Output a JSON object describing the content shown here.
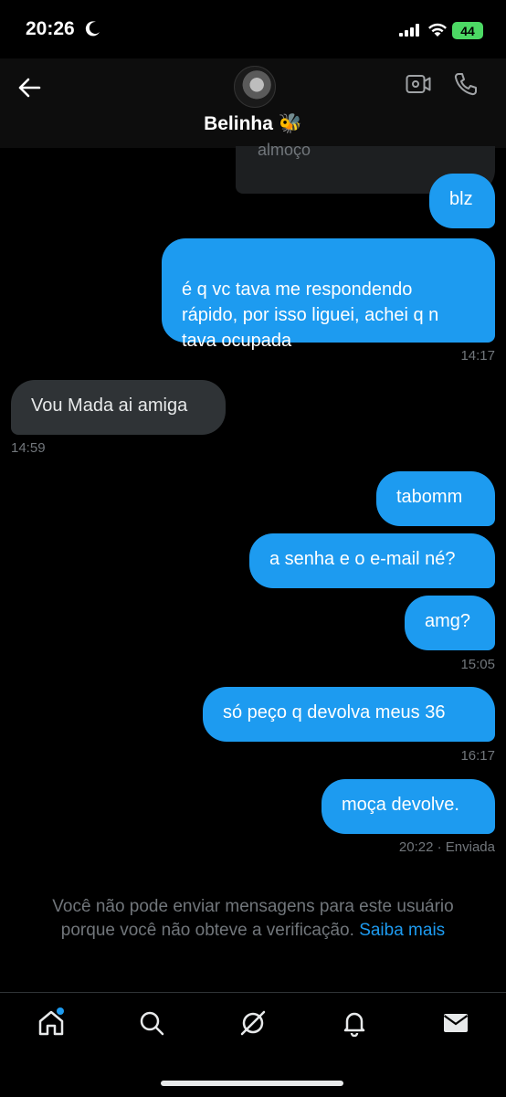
{
  "status_bar": {
    "time": "20:26",
    "battery": "44"
  },
  "header": {
    "contact_name": "Belinha 🐝"
  },
  "partial_message": "almoço",
  "messages": [
    {
      "text": "blz"
    },
    {
      "text": "é q vc tava me respondendo\nrápido, por isso liguei, achei q n\ntava ocupada"
    },
    {
      "text": "Vou Mada ai amiga"
    },
    {
      "text": "tabomm"
    },
    {
      "text": "a senha e o e-mail né?"
    },
    {
      "text": "amg?"
    },
    {
      "text": "só peço q devolva meus 36"
    },
    {
      "text": "moça devolve."
    }
  ],
  "timestamps": [
    "14:17",
    "14:59",
    "15:05",
    "16:17",
    "20:22 · Enviada"
  ],
  "notice": {
    "line1": "Você não pode enviar mensagens para este usuário",
    "line2": "porque você não obteve a verificação.",
    "link": "Saiba mais"
  },
  "nav": {
    "items": [
      {
        "icon": "home-icon"
      },
      {
        "icon": "search-icon"
      },
      {
        "icon": "grok-icon"
      },
      {
        "icon": "bell-icon"
      },
      {
        "icon": "mail-icon"
      }
    ]
  },
  "colors": {
    "accent": "#1d9bf0",
    "received_bubble": "#2f3336",
    "muted": "#71767b"
  }
}
